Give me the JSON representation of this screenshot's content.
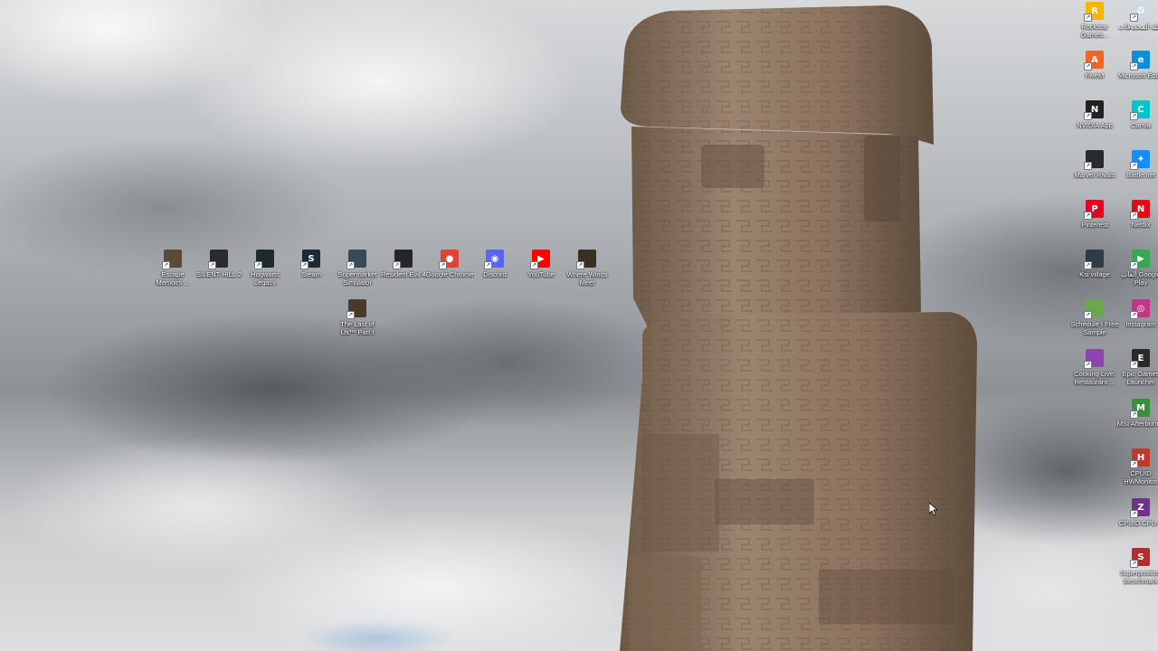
{
  "desktop_icons": [
    {
      "label": "Escape Memoirs ...",
      "icon": "game-thumbnail-icon",
      "color": "#5a4a3a"
    },
    {
      "label": "SILENT HILL 2",
      "icon": "game-thumbnail-icon",
      "color": "#2b2b2b"
    },
    {
      "label": "Hogwarts Legacy",
      "icon": "game-thumbnail-icon",
      "color": "#1e2a2e"
    },
    {
      "label": "Steam",
      "icon": "steam-icon",
      "color": "#1b2838"
    },
    {
      "label": "Supermarket Simulator",
      "icon": "game-thumbnail-icon",
      "color": "#3a4a5a"
    },
    {
      "label": "Resident Evil 4",
      "icon": "game-thumbnail-icon",
      "color": "#262626"
    },
    {
      "label": "Google Chrome",
      "icon": "chrome-icon",
      "color": "#db4437"
    },
    {
      "label": "Discord",
      "icon": "discord-icon",
      "color": "#5865f2"
    },
    {
      "label": "YouTube",
      "icon": "youtube-icon",
      "color": "#ff0000"
    },
    {
      "label": "Where Winds Meet",
      "icon": "game-thumbnail-icon",
      "color": "#3a3020"
    },
    {
      "label": "The Last of Us™ Part I",
      "icon": "game-thumbnail-icon",
      "color": "#4a3a2a"
    },
    {
      "label": "Rockstar Games...",
      "icon": "rockstar-icon",
      "color": "#f7b500"
    },
    {
      "label": "سلة المحذوفات",
      "icon": "recycle-bin-icon",
      "color": "#cfd8e3"
    },
    {
      "label": "FiveM",
      "icon": "fivem-icon",
      "color": "#f26522"
    },
    {
      "label": "Microsoft Edge",
      "icon": "edge-icon",
      "color": "#0c8fd9"
    },
    {
      "label": "NVIDIA App",
      "icon": "nvidia-icon",
      "color": "#222"
    },
    {
      "label": "Canva",
      "icon": "canva-icon",
      "color": "#00c4cc"
    },
    {
      "label": "Marvel Rivals",
      "icon": "game-thumbnail-icon",
      "color": "#2a2a2a"
    },
    {
      "label": "Battle.net",
      "icon": "battlenet-icon",
      "color": "#148eff"
    },
    {
      "label": "Pinterest",
      "icon": "pinterest-icon",
      "color": "#e60023"
    },
    {
      "label": "Netflix",
      "icon": "netflix-icon",
      "color": "#e50914"
    },
    {
      "label": "Ksi village",
      "icon": "game-thumbnail-icon",
      "color": "#2f3a44"
    },
    {
      "label": "ألعاب Google Play",
      "icon": "google-play-icon",
      "color": "#34a853"
    },
    {
      "label": "Schedule I Free Sample",
      "icon": "game-thumbnail-icon",
      "color": "#6aa84f"
    },
    {
      "label": "Instagram",
      "icon": "instagram-icon",
      "color": "#c13584"
    },
    {
      "label": "Cooking Live: Restaurant ...",
      "icon": "game-thumbnail-icon",
      "color": "#8e44ad"
    },
    {
      "label": "Epic Games Launcher",
      "icon": "epic-games-icon",
      "color": "#2a2a2a"
    },
    {
      "label": "MSI Afterburner",
      "icon": "msi-afterburner-icon",
      "color": "#3c8d3c"
    },
    {
      "label": "CPUID HWMonitor",
      "icon": "hwmonitor-icon",
      "color": "#c0392b"
    },
    {
      "label": "CPUID CPU-Z",
      "icon": "cpuz-icon",
      "color": "#6c3483"
    },
    {
      "label": "Superposition Benchmark",
      "icon": "superposition-icon",
      "color": "#b03030"
    }
  ]
}
